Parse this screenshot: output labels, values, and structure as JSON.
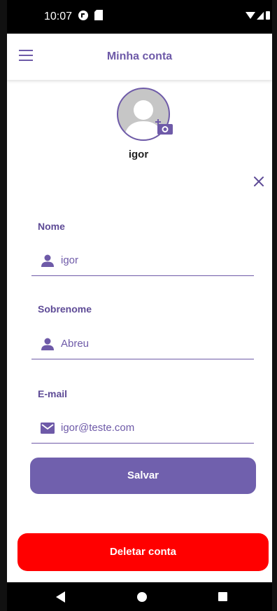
{
  "statusbar": {
    "time": "10:07"
  },
  "appbar": {
    "title": "Minha conta"
  },
  "profile": {
    "username": "igor"
  },
  "form": {
    "fields": [
      {
        "label": "Nome",
        "value": "igor",
        "icon": "person-icon"
      },
      {
        "label": "Sobrenome",
        "value": "Abreu",
        "icon": "person-icon"
      },
      {
        "label": "E-mail",
        "value": "igor@teste.com",
        "icon": "mail-icon"
      }
    ],
    "save_label": "Salvar"
  },
  "delete_label": "Deletar conta",
  "colors": {
    "accent": "#6e5aa8",
    "button": "#7060ad",
    "danger": "#ff0000"
  }
}
